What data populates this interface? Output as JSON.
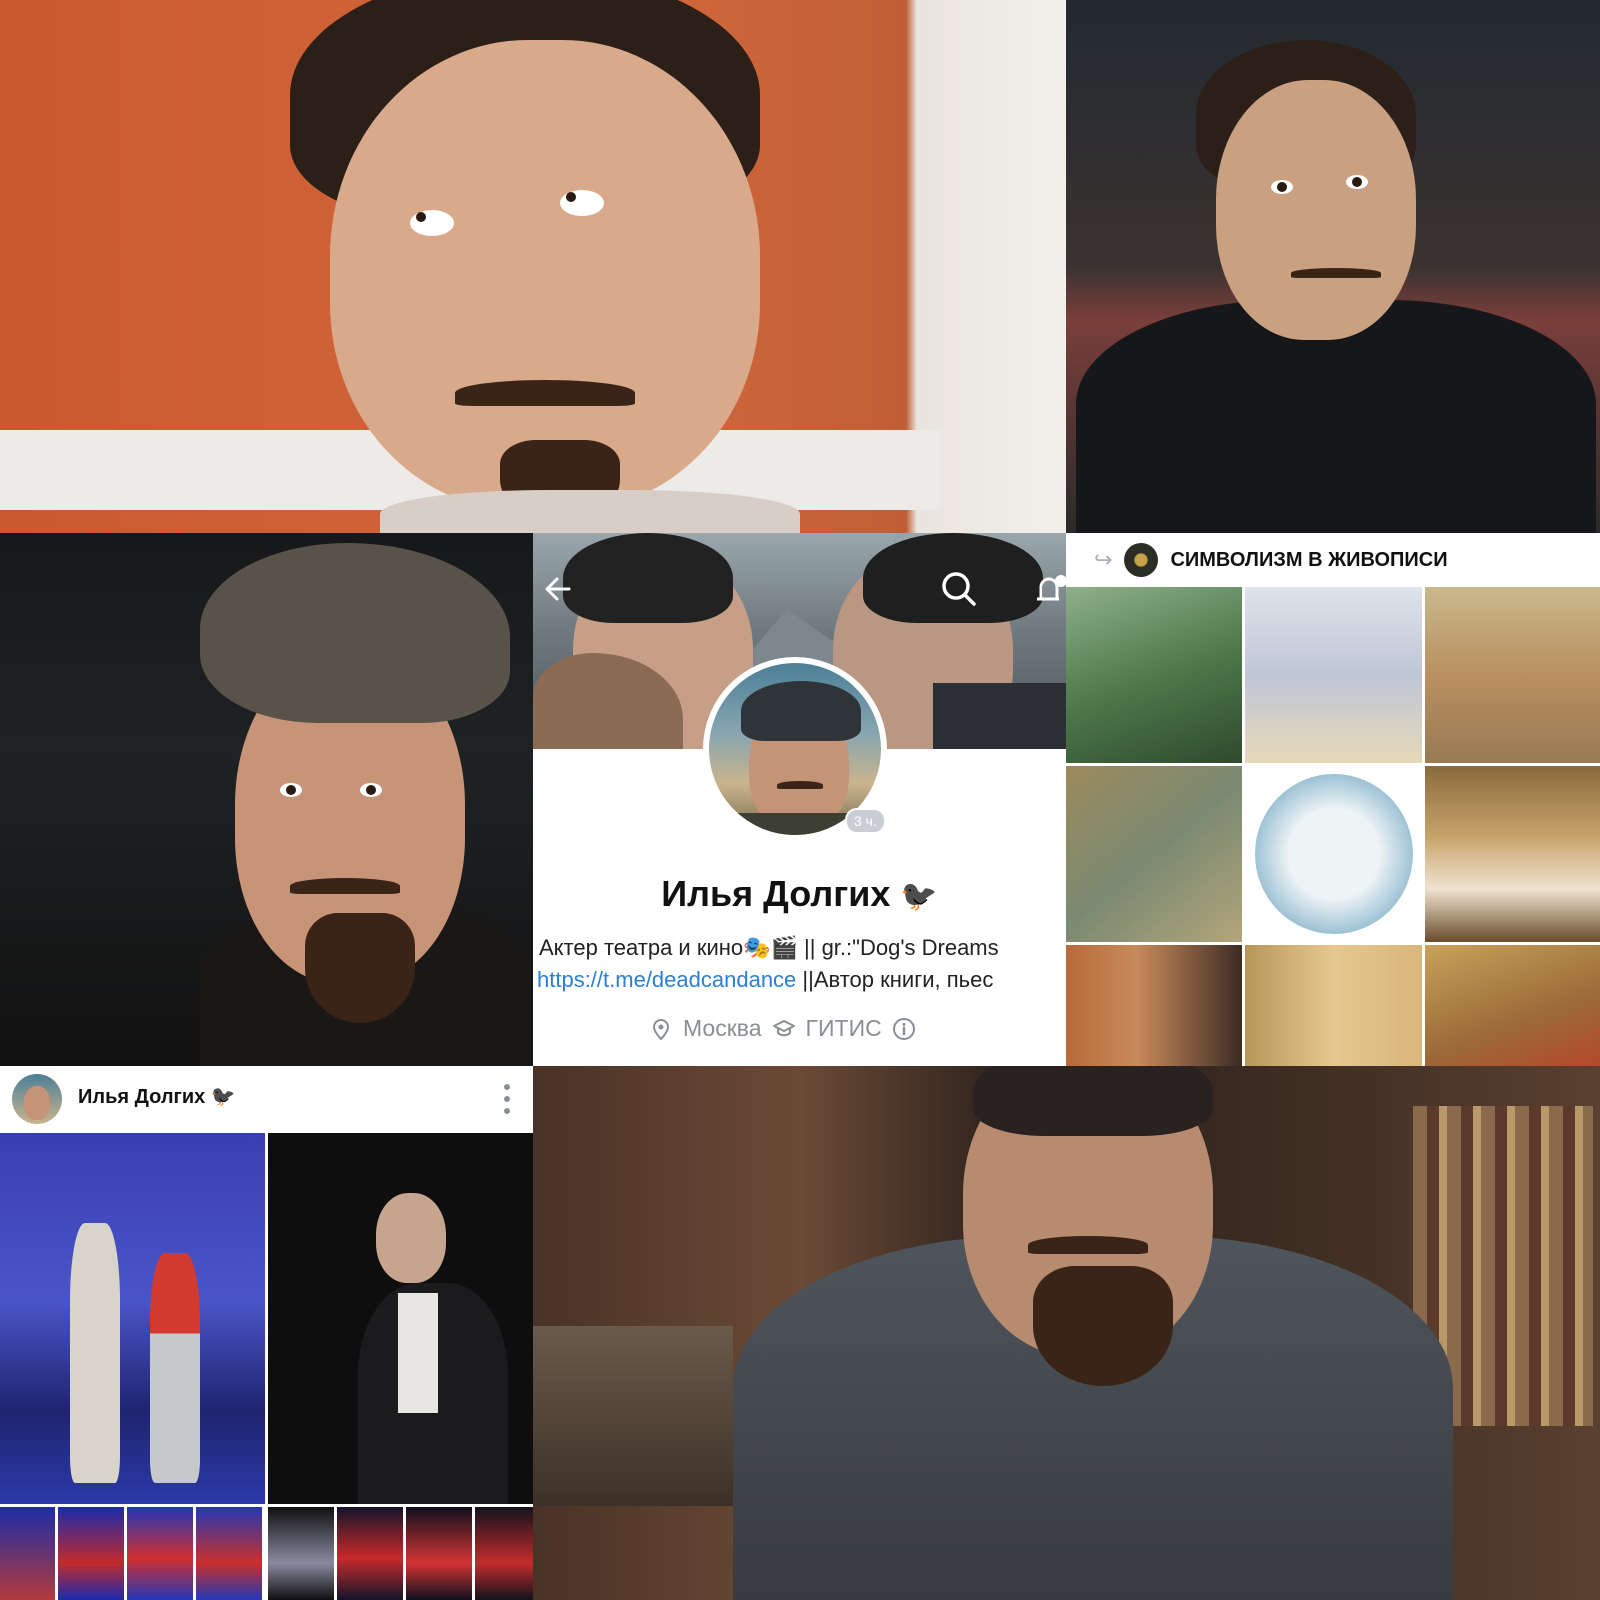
{
  "profile": {
    "time_badge": "3 ч.",
    "name": "Илья Долгих",
    "bio_line1": "Актер театра и кино🎭🎬 || gr.:\"Dog's Dreams",
    "bio_link": "https://t.me/deadcandance",
    "bio_line2_rest": " ||Автор книги, пьес",
    "city": "Москва",
    "university": "ГИТИС"
  },
  "repost_group": {
    "title": "СИМВОЛИЗМ В ЖИВОПИСИ"
  },
  "post": {
    "author": "Илья Долгих"
  },
  "colors": {
    "link": "#2b7fd6",
    "muted": "#8a8f96",
    "badge": "#c9ced4"
  },
  "icons": [
    "back-arrow-icon",
    "search-icon",
    "bell-plus-icon",
    "location-pin-icon",
    "graduation-cap-icon",
    "info-icon",
    "repost-icon",
    "more-vertical-icon",
    "bird-icon"
  ]
}
